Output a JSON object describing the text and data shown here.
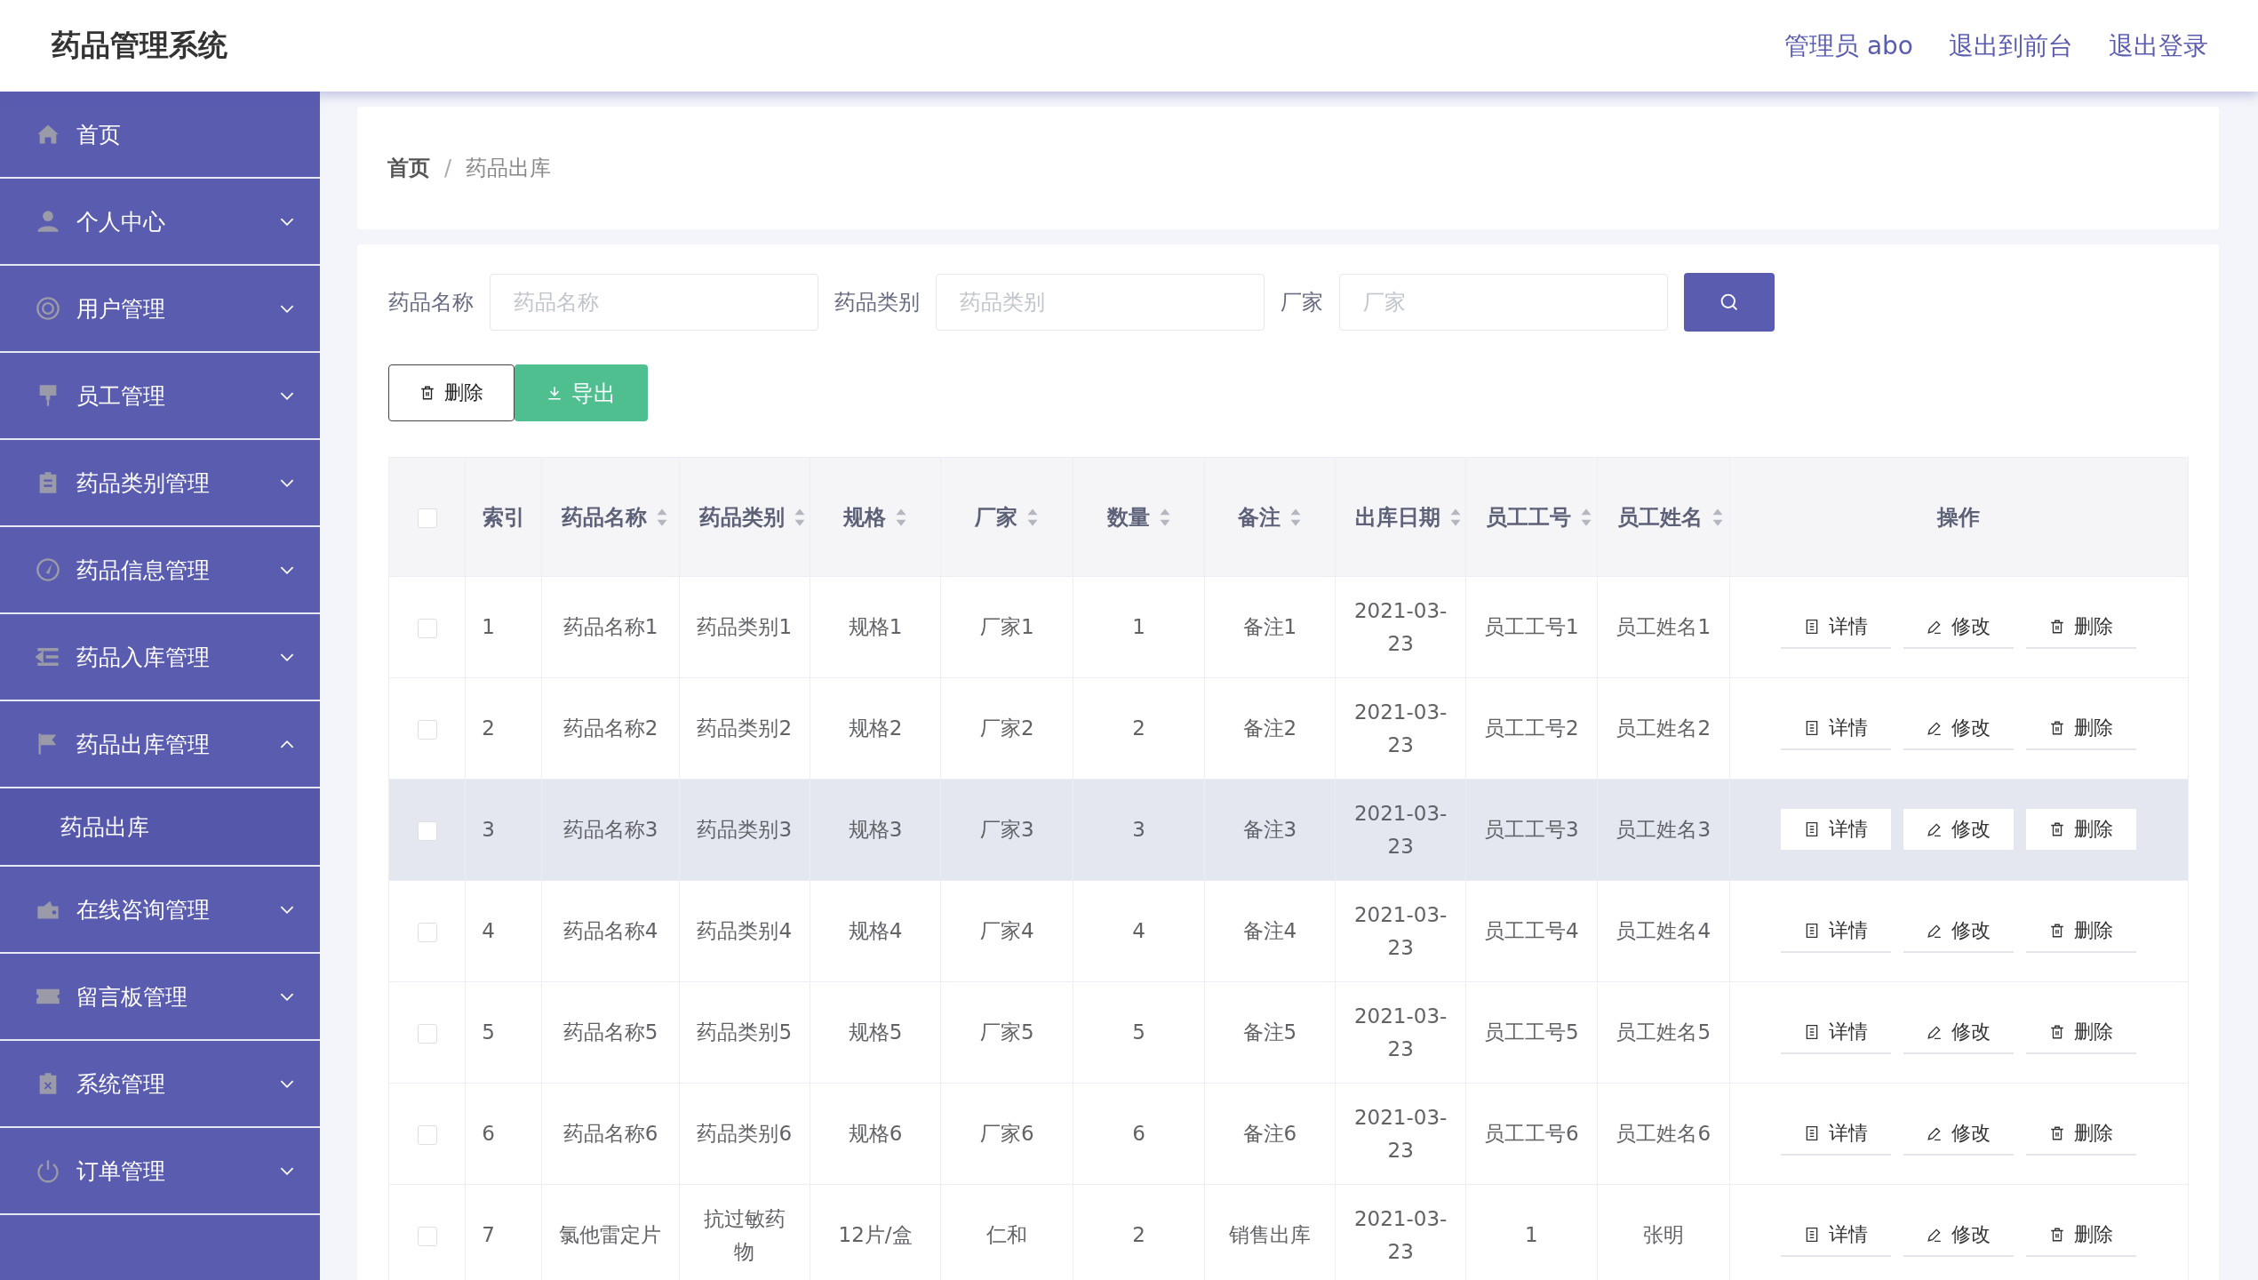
{
  "header": {
    "title": "药品管理系统",
    "links": [
      "管理员 abo",
      "退出到前台",
      "退出登录"
    ]
  },
  "sidebar": {
    "items": [
      {
        "kind": "link",
        "label": "首页"
      },
      {
        "kind": "menu",
        "label": "个人中心",
        "expanded": false
      },
      {
        "kind": "menu",
        "label": "用户管理",
        "expanded": false
      },
      {
        "kind": "menu",
        "label": "员工管理",
        "expanded": false
      },
      {
        "kind": "menu",
        "label": "药品类别管理",
        "expanded": false
      },
      {
        "kind": "menu",
        "label": "药品信息管理",
        "expanded": false
      },
      {
        "kind": "menu",
        "label": "药品入库管理",
        "expanded": false
      },
      {
        "kind": "menu",
        "label": "药品出库管理",
        "expanded": true,
        "children": [
          {
            "label": "药品出库"
          }
        ]
      },
      {
        "kind": "menu",
        "label": "在线咨询管理",
        "expanded": false
      },
      {
        "kind": "menu",
        "label": "留言板管理",
        "expanded": false
      },
      {
        "kind": "menu",
        "label": "系统管理",
        "expanded": false
      },
      {
        "kind": "menu",
        "label": "订单管理",
        "expanded": false
      }
    ]
  },
  "breadcrumb": {
    "items": [
      "首页",
      "药品出库"
    ],
    "separator": "/"
  },
  "search": {
    "fields": [
      {
        "label": "药品名称",
        "placeholder": "药品名称"
      },
      {
        "label": "药品类别",
        "placeholder": "药品类别"
      },
      {
        "label": "厂家",
        "placeholder": "厂家"
      }
    ]
  },
  "toolbar": {
    "buttons": [
      {
        "kind": "delete",
        "label": "删除"
      },
      {
        "kind": "export",
        "label": "导出"
      }
    ]
  },
  "table": {
    "select_all_checked": false,
    "columns": [
      {
        "label": "索引",
        "sortable": false
      },
      {
        "label": "药品名称",
        "sortable": true
      },
      {
        "label": "药品类别",
        "sortable": true
      },
      {
        "label": "规格",
        "sortable": true
      },
      {
        "label": "厂家",
        "sortable": true
      },
      {
        "label": "数量",
        "sortable": true
      },
      {
        "label": "备注",
        "sortable": true
      },
      {
        "label": "出库日期",
        "sortable": true
      },
      {
        "label": "员工工号",
        "sortable": true
      },
      {
        "label": "员工姓名",
        "sortable": true
      },
      {
        "label": "操作",
        "sortable": false
      }
    ],
    "rows": [
      {
        "checked": false,
        "highlighted": false,
        "cells": [
          "1",
          "药品名称1",
          "药品类别1",
          "规格1",
          "厂家1",
          "1",
          "备注1",
          "2021-03-23",
          "员工工号1",
          "员工姓名1"
        ],
        "actions": [
          {
            "kind": "detail",
            "label": "详情"
          },
          {
            "kind": "edit",
            "label": "修改"
          },
          {
            "kind": "delete",
            "label": "删除"
          }
        ]
      },
      {
        "checked": false,
        "highlighted": false,
        "cells": [
          "2",
          "药品名称2",
          "药品类别2",
          "规格2",
          "厂家2",
          "2",
          "备注2",
          "2021-03-23",
          "员工工号2",
          "员工姓名2"
        ],
        "actions": [
          {
            "kind": "detail",
            "label": "详情"
          },
          {
            "kind": "edit",
            "label": "修改"
          },
          {
            "kind": "delete",
            "label": "删除"
          }
        ]
      },
      {
        "checked": false,
        "highlighted": true,
        "cells": [
          "3",
          "药品名称3",
          "药品类别3",
          "规格3",
          "厂家3",
          "3",
          "备注3",
          "2021-03-23",
          "员工工号3",
          "员工姓名3"
        ],
        "actions": [
          {
            "kind": "detail",
            "label": "详情"
          },
          {
            "kind": "edit",
            "label": "修改"
          },
          {
            "kind": "delete",
            "label": "删除"
          }
        ]
      },
      {
        "checked": false,
        "highlighted": false,
        "cells": [
          "4",
          "药品名称4",
          "药品类别4",
          "规格4",
          "厂家4",
          "4",
          "备注4",
          "2021-03-23",
          "员工工号4",
          "员工姓名4"
        ],
        "actions": [
          {
            "kind": "detail",
            "label": "详情"
          },
          {
            "kind": "edit",
            "label": "修改"
          },
          {
            "kind": "delete",
            "label": "删除"
          }
        ]
      },
      {
        "checked": false,
        "highlighted": false,
        "cells": [
          "5",
          "药品名称5",
          "药品类别5",
          "规格5",
          "厂家5",
          "5",
          "备注5",
          "2021-03-23",
          "员工工号5",
          "员工姓名5"
        ],
        "actions": [
          {
            "kind": "detail",
            "label": "详情"
          },
          {
            "kind": "edit",
            "label": "修改"
          },
          {
            "kind": "delete",
            "label": "删除"
          }
        ]
      },
      {
        "checked": false,
        "highlighted": false,
        "cells": [
          "6",
          "药品名称6",
          "药品类别6",
          "规格6",
          "厂家6",
          "6",
          "备注6",
          "2021-03-23",
          "员工工号6",
          "员工姓名6"
        ],
        "actions": [
          {
            "kind": "detail",
            "label": "详情"
          },
          {
            "kind": "edit",
            "label": "修改"
          },
          {
            "kind": "delete",
            "label": "删除"
          }
        ]
      },
      {
        "checked": false,
        "highlighted": false,
        "cells": [
          "7",
          "氯他雷定片",
          "抗过敏药物",
          "12片/盒",
          "仁和",
          "2",
          "销售出库",
          "2021-03-23",
          "1",
          "张明"
        ],
        "actions": [
          {
            "kind": "detail",
            "label": "详情"
          },
          {
            "kind": "edit",
            "label": "修改"
          },
          {
            "kind": "delete",
            "label": "删除"
          }
        ]
      }
    ]
  }
}
